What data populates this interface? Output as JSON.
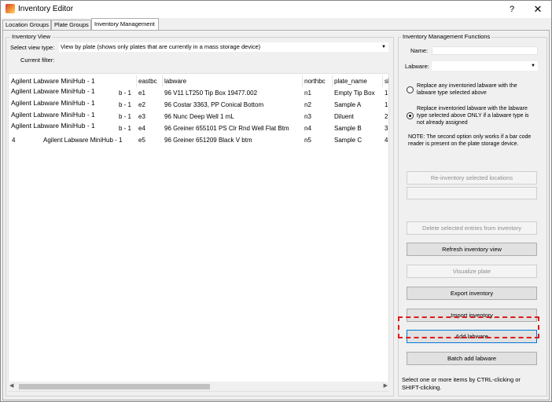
{
  "window": {
    "title": "Inventory Editor",
    "help": "?",
    "close": "✕",
    "icon": "inventory-app-icon"
  },
  "tabs": [
    {
      "label": "Location Groups",
      "active": false
    },
    {
      "label": "Plate Groups",
      "active": false
    },
    {
      "label": "Inventory Management",
      "active": true
    }
  ],
  "inventory_view": {
    "title": "Inventory View",
    "view_type_label": "Select view type:",
    "view_type_value": "View by plate (shows only plates that are currently in a mass storage device)",
    "current_filter_label": "Current filter:",
    "columns": [
      "",
      "eastbc",
      "labware",
      "northbc",
      "plate_name",
      "sl"
    ],
    "rows": [
      {
        "name": "Agilent Labware MiniHub - 1",
        "prefix": "",
        "mid": "b - 1",
        "eastbc": "e1",
        "labware": "96 V11 LT250 Tip Box 19477.002",
        "northbc": "n1",
        "plate_name": "Empty Tip Box",
        "sl": "1"
      },
      {
        "name": "Agilent Labware MiniHub - 1",
        "prefix": "",
        "mid": "b - 1",
        "eastbc": "e2",
        "labware": "96 Costar 3363, PP Conical Bottom",
        "northbc": "n2",
        "plate_name": "Sample A",
        "sl": "1"
      },
      {
        "name": "Agilent Labware MiniHub - 1",
        "prefix": "",
        "mid": "b - 1",
        "eastbc": "e3",
        "labware": "96 Nunc Deep Well 1 mL",
        "northbc": "n3",
        "plate_name": "Diluent",
        "sl": "2"
      },
      {
        "name": "Agilent Labware MiniHub - 1",
        "prefix": "",
        "mid": "b - 1",
        "eastbc": "e4",
        "labware": "96 Greiner 655101 PS Clr Rnd Well Flat Btm",
        "northbc": "n4",
        "plate_name": "Sample B",
        "sl": "3"
      },
      {
        "name": "",
        "prefix": "4",
        "mid": "Agilent Labware MiniHub - 1",
        "eastbc": "e5",
        "labware": "96 Greiner 651209 Black V btm",
        "northbc": "n5",
        "plate_name": "Sample C",
        "sl": "4"
      }
    ]
  },
  "functions": {
    "title": "Inventory Management Functions",
    "name_label": "Name:",
    "name_value": "",
    "labware_label": "Labware:",
    "labware_value": "",
    "radio_replace_any": "Replace any inventoried labware with the labware type selected above",
    "radio_replace_only": "Replace inventoried labware with the labware type selected above ONLY if a labware type is not already assigned",
    "note": "NOTE: The second option only works if a bar code reader is present on the plate storage device.",
    "buttons": {
      "reinventory": "Re-inventory selected locations",
      "delete": "Delete selected entries from inventory",
      "refresh": "Refresh inventory view",
      "visualize": "Visualize plate",
      "export": "Export inventory",
      "import": "Import inventory",
      "add": "Add labware",
      "batch_add": "Batch add labware"
    },
    "hint": "Select one or more items by CTRL-clicking or SHIFT-clicking."
  },
  "colors": {
    "highlight": "#e01a1a",
    "focus": "#0078d7"
  }
}
